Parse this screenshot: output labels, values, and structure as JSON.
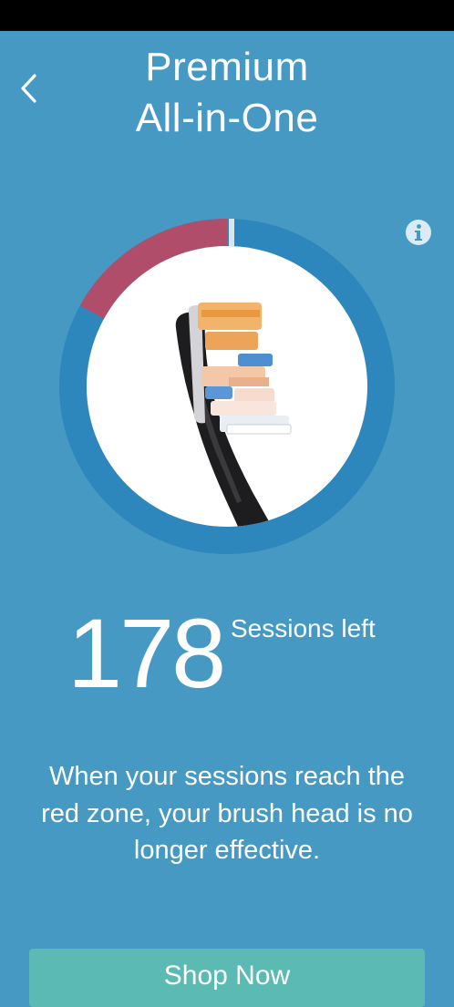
{
  "header": {
    "title_line1": "Premium",
    "title_line2": "All-in-One",
    "back_icon": "chevron-left-icon",
    "info_icon": "info-icon"
  },
  "gauge": {
    "remaining_fraction": 0.83,
    "colors": {
      "track": "#2e87bc",
      "red_zone": "#b04d6b",
      "marker": "#d5e8f2",
      "inner": "#ffffff"
    }
  },
  "sessions": {
    "count": "178",
    "label": "Sessions left"
  },
  "explanation": "When your sessions reach the red zone, your brush head is no longer effective.",
  "cta": {
    "label": "Shop Now",
    "color": "#5bbab4"
  }
}
